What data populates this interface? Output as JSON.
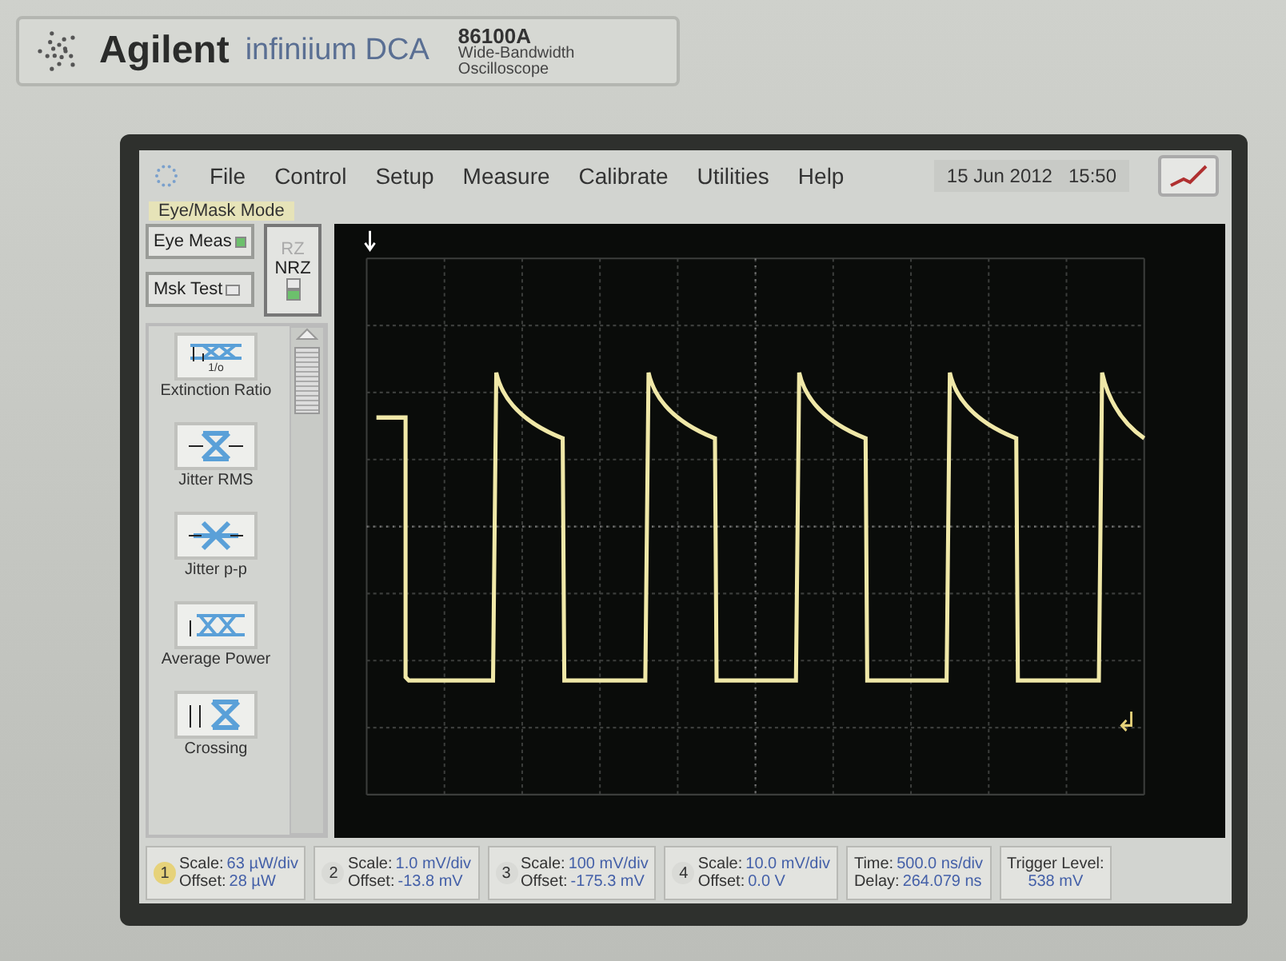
{
  "brand": {
    "logo": "Agilent",
    "product": "infiniium DCA",
    "model": "86100A",
    "description": [
      "Wide-Bandwidth",
      "Oscilloscope"
    ]
  },
  "menu": [
    {
      "label": "File"
    },
    {
      "label": "Control"
    },
    {
      "label": "Setup"
    },
    {
      "label": "Measure"
    },
    {
      "label": "Calibrate"
    },
    {
      "label": "Utilities"
    },
    {
      "label": "Help"
    }
  ],
  "clock": {
    "date": "15 Jun 2012",
    "time": "15:50"
  },
  "mode_label": "Eye/Mask Mode",
  "mode_buttons": [
    {
      "label": "Eye Meas",
      "on": true
    },
    {
      "label": "Msk Test",
      "on": false
    }
  ],
  "signal_types": [
    {
      "label": "RZ",
      "on": false
    },
    {
      "label": "NRZ",
      "on": true
    }
  ],
  "measurements": [
    {
      "label": "Extinction Ratio",
      "kind": "extinction",
      "icon_text": "1/o"
    },
    {
      "label": "Jitter RMS",
      "kind": "jitter-rms"
    },
    {
      "label": "Jitter p-p",
      "kind": "jitter-pp"
    },
    {
      "label": "Average Power",
      "kind": "power"
    },
    {
      "label": "Crossing",
      "kind": "crossing"
    }
  ],
  "channels": [
    {
      "number": "1",
      "color": "#e6d27a",
      "scale_label": "Scale:",
      "scale": "63 µW/div",
      "offset_label": "Offset:",
      "offset": "28 µW"
    },
    {
      "number": "2",
      "color": "#d9dad6",
      "scale_label": "Scale:",
      "scale": "1.0 mV/div",
      "offset_label": "Offset:",
      "offset": "-13.8 mV"
    },
    {
      "number": "3",
      "color": "#d9dad6",
      "scale_label": "Scale:",
      "scale": "100 mV/div",
      "offset_label": "Offset:",
      "offset": "-175.3 mV"
    },
    {
      "number": "4",
      "color": "#d9dad6",
      "scale_label": "Scale:",
      "scale": "10.0 mV/div",
      "offset_label": "Offset:",
      "offset": "0.0 V"
    }
  ],
  "timebase": {
    "time_label": "Time:",
    "time": "500.0 ns/div",
    "delay_label": "Delay:",
    "delay": "264.079 ns"
  },
  "trigger": {
    "label": "Trigger Level:",
    "value": "538 mV"
  }
}
